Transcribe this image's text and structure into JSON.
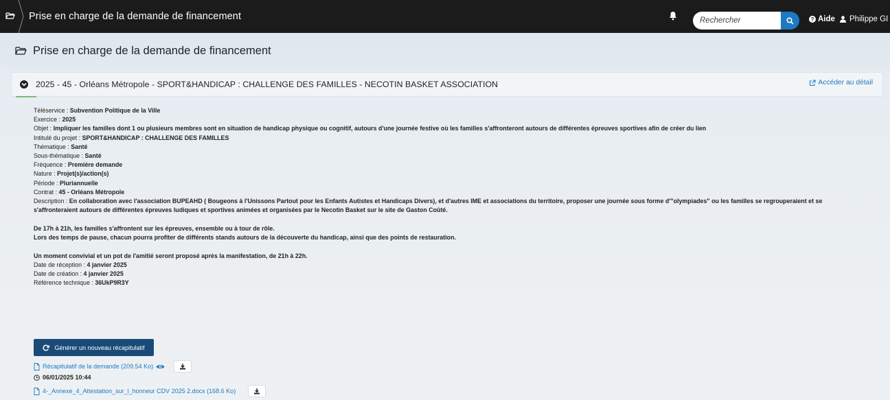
{
  "topbar": {
    "title": "Prise en charge de la demande de financement",
    "search_placeholder": "Rechercher",
    "help_label": "Aide",
    "user_label": "Philippe GI"
  },
  "page": {
    "title": "Prise en charge de la demande de financement"
  },
  "panel": {
    "title": "2025 - 45 - Orléans Métropole - SPORT&HANDICAP : CHALLENGE DES FAMILLES - NECOTIN BASKET ASSOCIATION",
    "detail_link": "Accéder au détail"
  },
  "fields": [
    {
      "label": "Téléservice : ",
      "value": "Subvention Politique de la Ville"
    },
    {
      "label": "Exercice : ",
      "value": "2025"
    },
    {
      "label": "Objet : ",
      "value": "Impliquer les familles dont 1 ou plusieurs membres sont en situation de handicap physique ou cognitif, autours d'une journée festive où les familles s'affronteront autours de différentes épreuves sportives afin de créer du lien"
    },
    {
      "label": "Intitulé du projet : ",
      "value": "SPORT&HANDICAP : CHALLENGE DES FAMILLES"
    },
    {
      "label": "Thématique : ",
      "value": "Santé"
    },
    {
      "label": "Sous-thématique : ",
      "value": "Santé"
    },
    {
      "label": "Fréquence : ",
      "value": "Première demande"
    },
    {
      "label": "Nature : ",
      "value": "Projet(s)/action(s)"
    },
    {
      "label": "Période : ",
      "value": "Pluriannuelle"
    },
    {
      "label": "Contrat : ",
      "value": "45 - Orléans Métropole"
    }
  ],
  "description": {
    "label": "Description : ",
    "line1": "En collaboration avec l'association BUPEAHD ( Bougeons à l'Unissons Partout pour les Enfants Autistes et Handicaps Divers), et d'autres IME et associations du territoire, proposer une journée sous forme d'\"olympiades\" ou les familles se regrouperaient et se",
    "line2": "s'affronteraient autours de différentes épreuves ludiques et sportives animées et organisées par le Necotin Basket sur le site de Gaston Coûté.",
    "para2_1": "De 17h à 21h, les familles s'affrontent sur les épreuves, ensemble ou à tour de rôle.",
    "para2_2": "Lors des temps de pause, chacun pourra profiter de différents stands autours de la découverte du handicap, ainsi que des points de restauration.",
    "para3": "Un moment convivial et un pot de l'amitié seront proposé après la manifestation, de 21h à 22h."
  },
  "fields_after": [
    {
      "label": "Date de réception : ",
      "value": "4 janvier 2025"
    },
    {
      "label": "Date de création : ",
      "value": "4 janvier 2025"
    },
    {
      "label": "Référence technique : ",
      "value": "36UkP9R3Y"
    }
  ],
  "actions": {
    "generate_label": "Générer un nouveau récapitulatif",
    "recap_file": "Récapitulatif de la demande (209.54 Ko)",
    "timestamp": "06/01/2025 10:44",
    "annex_file": "4-_Annexe_4_Attestation_sur_l_honneur CDV 2025 2.docx (168.6 Ko)"
  },
  "colors": {
    "topbar_bg": "#1b1b1b",
    "accent": "#1f79c2",
    "primary_button": "#1a4b78"
  },
  "icons": [
    "folder-open-icon",
    "bell-icon",
    "search-icon",
    "question-circle-icon",
    "user-icon",
    "chevron-down-circle-icon",
    "external-link-icon",
    "refresh-icon",
    "file-icon",
    "eye-icon",
    "download-icon",
    "clock-icon"
  ]
}
